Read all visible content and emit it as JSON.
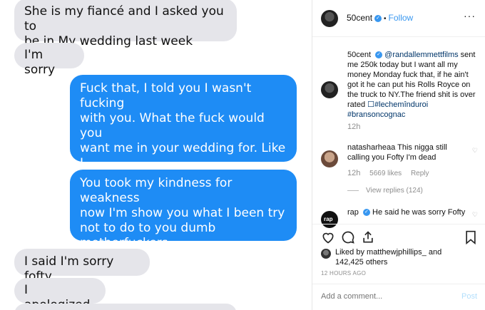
{
  "conversation": {
    "messages": [
      {
        "side": "received",
        "text": "She is my fiancé and I asked you to\nbe in My wedding last week"
      },
      {
        "side": "received",
        "text": "I'm sorry"
      },
      {
        "side": "sent",
        "text": "Fuck that, I told you I wasn't fucking\nwith you. What the fuck would you\nwant me in your wedding for. Like I\nain't got shit else to do. Get the\nfuck outta here."
      },
      {
        "side": "sent",
        "text": "You took my kindness for weakness\nnow I'm show you what I been try\nnot to do to you dumb\nmotherfuckers."
      },
      {
        "side": "received",
        "text": "I said I'm sorry fofty"
      },
      {
        "side": "received",
        "text": "I apologized"
      },
      {
        "side": "received",
        "text": ""
      }
    ]
  },
  "post": {
    "username": "50cent",
    "follow_label": "Follow",
    "more_label": "···",
    "caption": {
      "username": "50cent",
      "mention": "@randallemmettfilms",
      "text": " sent me 250k today but I want all my money Monday fuck that, if he ain't got it he can put his Rolls Royce on the truck to NY.The friend shit is over rated ",
      "hashtags": "☐#lechemînduroi #bransoncognac",
      "time": "12h"
    },
    "comments": [
      {
        "username": "natasharheaa",
        "text": "This nigga still calling you Fofty I'm dead",
        "time": "12h",
        "likes": "5669 likes",
        "reply": "Reply",
        "view_replies": "View replies (124)"
      },
      {
        "username": "rap",
        "text": "He said he was sorry Fofty"
      }
    ],
    "liked_by": {
      "prefix": "Liked by ",
      "user": "matthewjphillips_",
      "and": " and",
      "others": "142,425 others"
    },
    "timestamp": "12 HOURS AGO",
    "add_comment_placeholder": "Add a comment...",
    "post_label": "Post",
    "icons": [
      "heart-icon",
      "comment-icon",
      "share-icon",
      "bookmark-icon"
    ]
  },
  "colors": {
    "imessage_blue": "#1e8cf5",
    "imessage_gray": "#e5e5ea",
    "link": "#003569",
    "follow": "#3897f0"
  }
}
